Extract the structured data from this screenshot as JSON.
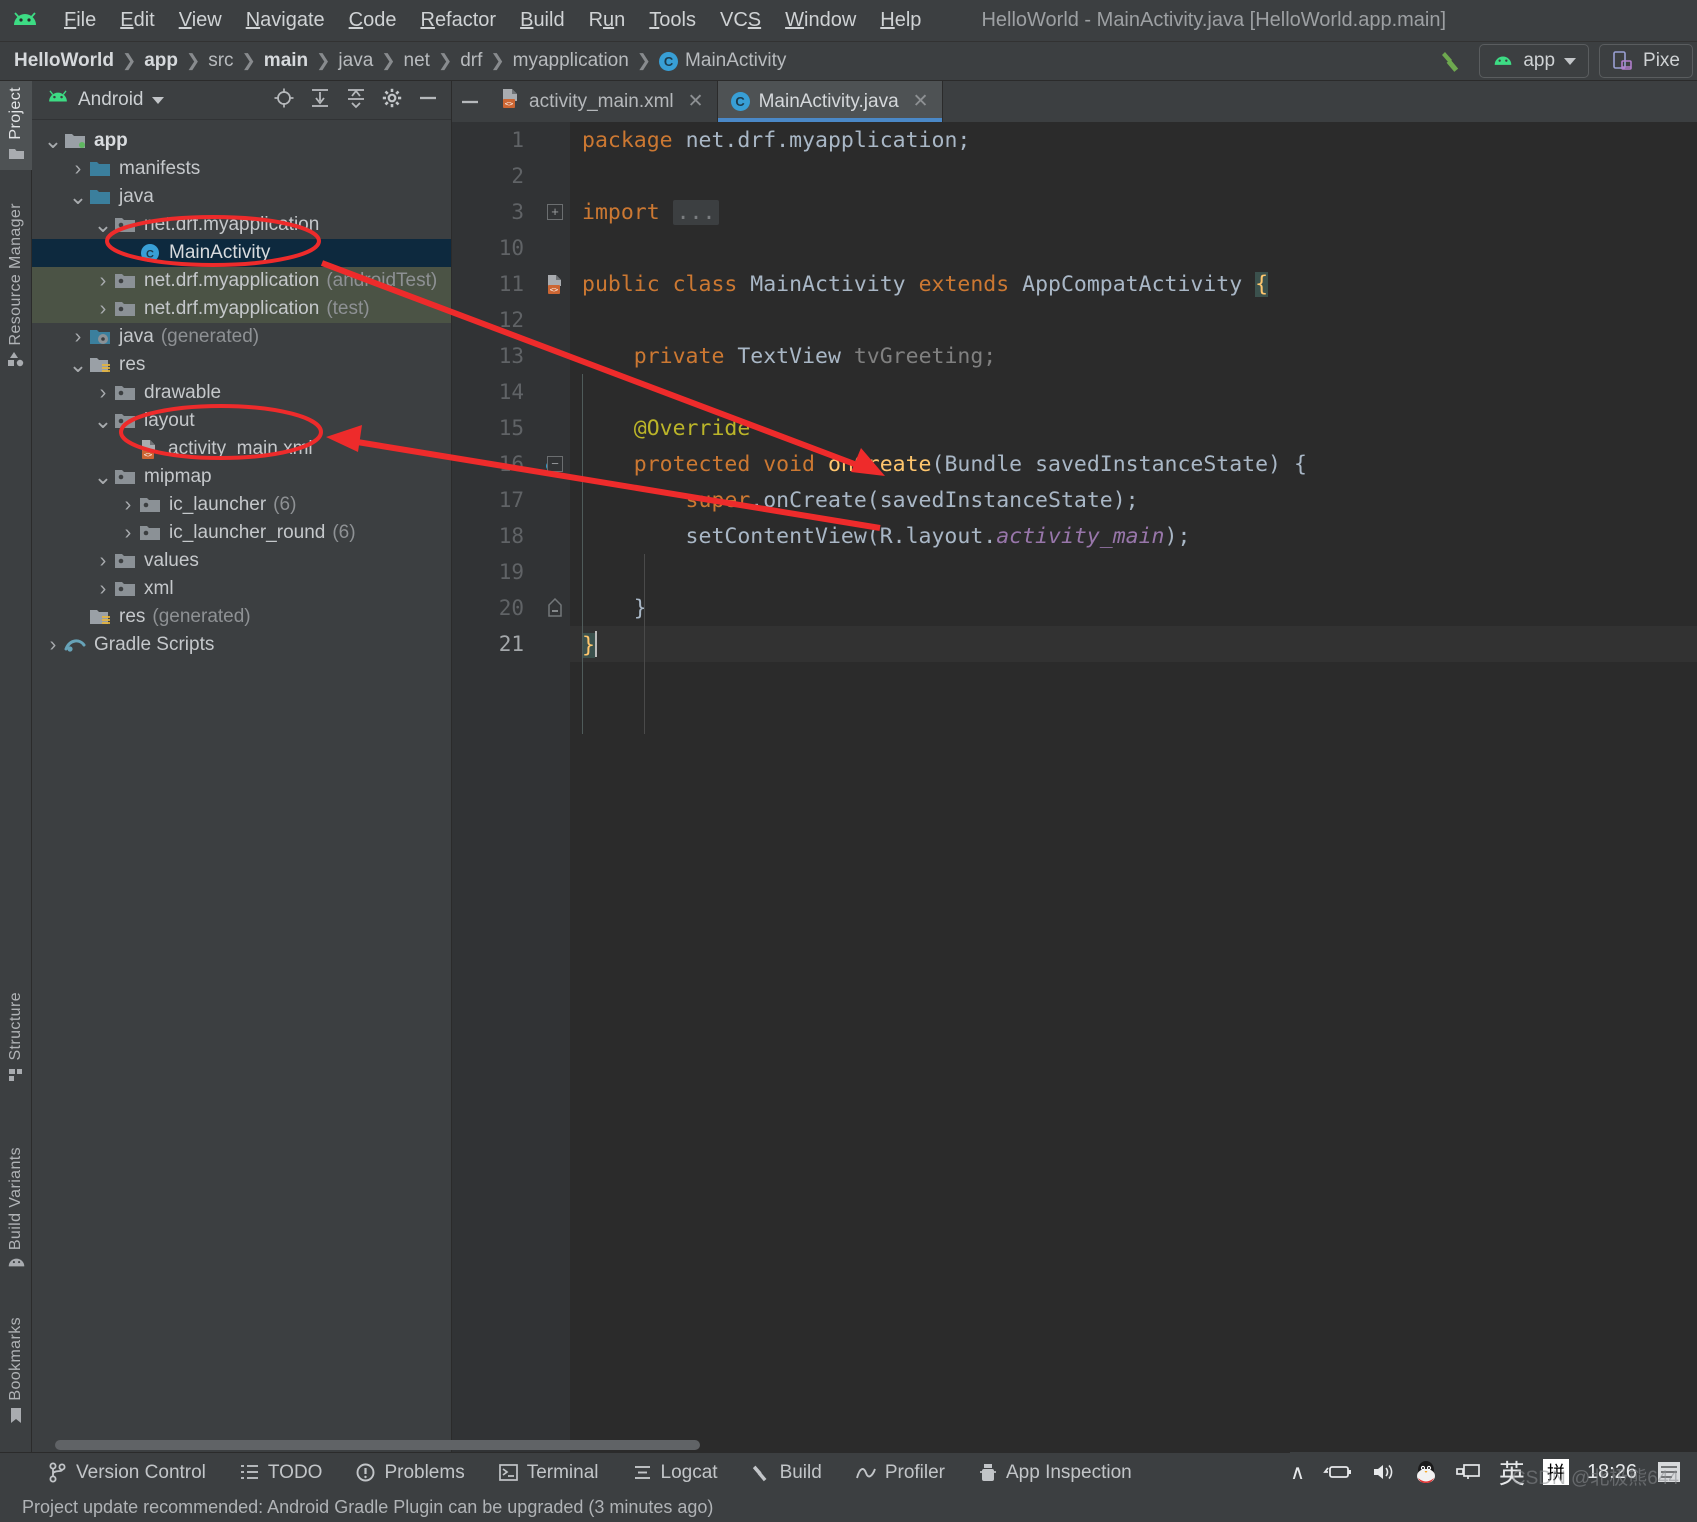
{
  "window": {
    "title": "HelloWorld - MainActivity.java [HelloWorld.app.main]",
    "app_icon": "android-robot-icon"
  },
  "menubar": {
    "items": [
      {
        "label": "File",
        "mnemonic": "F"
      },
      {
        "label": "Edit",
        "mnemonic": "E"
      },
      {
        "label": "View",
        "mnemonic": "V"
      },
      {
        "label": "Navigate",
        "mnemonic": "N"
      },
      {
        "label": "Code",
        "mnemonic": "C"
      },
      {
        "label": "Refactor",
        "mnemonic": "R"
      },
      {
        "label": "Build",
        "mnemonic": "B"
      },
      {
        "label": "Run",
        "mnemonic": "u"
      },
      {
        "label": "Tools",
        "mnemonic": "T"
      },
      {
        "label": "VCS",
        "mnemonic": "S"
      },
      {
        "label": "Window",
        "mnemonic": "W"
      },
      {
        "label": "Help",
        "mnemonic": "H"
      }
    ]
  },
  "breadcrumb": {
    "items": [
      {
        "label": "HelloWorld",
        "bold": true
      },
      {
        "label": "app",
        "bold": true
      },
      {
        "label": "src",
        "bold": false
      },
      {
        "label": "main",
        "bold": true
      },
      {
        "label": "java",
        "bold": false
      },
      {
        "label": "net",
        "bold": false
      },
      {
        "label": "drf",
        "bold": false
      },
      {
        "label": "myapplication",
        "bold": false
      },
      {
        "label": "MainActivity",
        "bold": false,
        "icon": "java-class-icon"
      }
    ],
    "separator": "〉"
  },
  "toolbar_right": {
    "build_icon": "hammer-icon",
    "run_config": "app",
    "run_config_icon": "android-robot-icon",
    "device": "Pixe",
    "device_icon": "device-phone-icon"
  },
  "left_tool_strip": {
    "top": [
      {
        "label": "Project",
        "icon": "folder-icon",
        "active": true
      },
      {
        "label": "Resource Manager",
        "icon": "shapes-icon",
        "active": false
      }
    ],
    "bottom": [
      {
        "label": "Structure",
        "icon": "structure-icon",
        "active": false
      },
      {
        "label": "Build Variants",
        "icon": "android-robot-icon",
        "active": false
      },
      {
        "label": "Bookmarks",
        "icon": "bookmark-icon",
        "active": false
      }
    ]
  },
  "project_panel": {
    "title": "Android",
    "title_icon": "android-robot-icon",
    "header_buttons": [
      {
        "name": "locate-icon"
      },
      {
        "name": "expand-all-icon"
      },
      {
        "name": "collapse-all-icon"
      },
      {
        "name": "gear-icon"
      },
      {
        "name": "minimize-icon"
      }
    ],
    "tree": [
      {
        "indent": 0,
        "chevron": "⌄",
        "icon": "module-folder-icon",
        "label": "app",
        "suffix": "",
        "bold": true,
        "selected": false,
        "testsrc": false
      },
      {
        "indent": 1,
        "chevron": "›",
        "icon": "folder-icon",
        "label": "manifests",
        "suffix": "",
        "bold": false,
        "selected": false,
        "testsrc": false
      },
      {
        "indent": 1,
        "chevron": "⌄",
        "icon": "folder-icon",
        "label": "java",
        "suffix": "",
        "bold": false,
        "selected": false,
        "testsrc": false
      },
      {
        "indent": 2,
        "chevron": "⌄",
        "icon": "package-icon",
        "label": "net.drf.myapplication",
        "suffix": "",
        "bold": false,
        "selected": false,
        "testsrc": false
      },
      {
        "indent": 3,
        "chevron": "",
        "icon": "java-class-icon",
        "label": "MainActivity",
        "suffix": "",
        "bold": false,
        "selected": true,
        "testsrc": false
      },
      {
        "indent": 2,
        "chevron": "›",
        "icon": "package-icon",
        "label": "net.drf.myapplication",
        "suffix": "(androidTest)",
        "bold": false,
        "selected": false,
        "testsrc": true
      },
      {
        "indent": 2,
        "chevron": "›",
        "icon": "package-icon",
        "label": "net.drf.myapplication",
        "suffix": "(test)",
        "bold": false,
        "selected": false,
        "testsrc": true
      },
      {
        "indent": 1,
        "chevron": "›",
        "icon": "generated-folder-icon",
        "label": "java",
        "suffix": "(generated)",
        "bold": false,
        "selected": false,
        "testsrc": false
      },
      {
        "indent": 1,
        "chevron": "⌄",
        "icon": "res-folder-icon",
        "label": "res",
        "suffix": "",
        "bold": false,
        "selected": false,
        "testsrc": false
      },
      {
        "indent": 2,
        "chevron": "›",
        "icon": "package-icon",
        "label": "drawable",
        "suffix": "",
        "bold": false,
        "selected": false,
        "testsrc": false
      },
      {
        "indent": 2,
        "chevron": "⌄",
        "icon": "package-icon",
        "label": "layout",
        "suffix": "",
        "bold": false,
        "selected": false,
        "testsrc": false
      },
      {
        "indent": 3,
        "chevron": "",
        "icon": "xml-layout-icon",
        "label": "activity_main.xml",
        "suffix": "",
        "bold": false,
        "selected": false,
        "testsrc": false
      },
      {
        "indent": 2,
        "chevron": "⌄",
        "icon": "package-icon",
        "label": "mipmap",
        "suffix": "",
        "bold": false,
        "selected": false,
        "testsrc": false
      },
      {
        "indent": 3,
        "chevron": "›",
        "icon": "package-icon",
        "label": "ic_launcher",
        "suffix": "(6)",
        "bold": false,
        "selected": false,
        "testsrc": false
      },
      {
        "indent": 3,
        "chevron": "›",
        "icon": "package-icon",
        "label": "ic_launcher_round",
        "suffix": "(6)",
        "bold": false,
        "selected": false,
        "testsrc": false
      },
      {
        "indent": 2,
        "chevron": "›",
        "icon": "package-icon",
        "label": "values",
        "suffix": "",
        "bold": false,
        "selected": false,
        "testsrc": false
      },
      {
        "indent": 2,
        "chevron": "›",
        "icon": "package-icon",
        "label": "xml",
        "suffix": "",
        "bold": false,
        "selected": false,
        "testsrc": false
      },
      {
        "indent": 1,
        "chevron": "",
        "icon": "res-folder-icon",
        "label": "res",
        "suffix": "(generated)",
        "bold": false,
        "selected": false,
        "testsrc": false
      },
      {
        "indent": 0,
        "chevron": "›",
        "icon": "gradle-icon",
        "label": "Gradle Scripts",
        "suffix": "",
        "bold": false,
        "selected": false,
        "testsrc": false
      }
    ]
  },
  "editor": {
    "tabs": [
      {
        "label": "activity_main.xml",
        "icon": "xml-layout-icon",
        "active": false
      },
      {
        "label": "MainActivity.java",
        "icon": "java-class-icon",
        "active": true
      }
    ],
    "minimize_icon": "minimize-icon",
    "lines": [
      {
        "num": "1",
        "segments": [
          {
            "t": "package ",
            "c": "kw"
          },
          {
            "t": "net.drf.myapplication;",
            "c": "plain"
          }
        ]
      },
      {
        "num": "2",
        "segments": []
      },
      {
        "num": "3",
        "segments": [
          {
            "t": "import ",
            "c": "kw"
          },
          {
            "t": "...",
            "c": "fold-chip"
          }
        ],
        "fold": true
      },
      {
        "num": "10",
        "segments": []
      },
      {
        "num": "11",
        "segments": [
          {
            "t": "public class ",
            "c": "kw"
          },
          {
            "t": "MainActivity ",
            "c": "plain"
          },
          {
            "t": "extends ",
            "c": "kw"
          },
          {
            "t": "AppCompatActivity ",
            "c": "plain"
          },
          {
            "t": "{",
            "c": "brace-hl"
          }
        ],
        "marker": "xml-layout-icon"
      },
      {
        "num": "12",
        "segments": []
      },
      {
        "num": "13",
        "segments": [
          {
            "t": "    private ",
            "c": "kw"
          },
          {
            "t": "TextView ",
            "c": "plain"
          },
          {
            "t": "tvGreeting;",
            "c": "dim"
          }
        ]
      },
      {
        "num": "14",
        "segments": []
      },
      {
        "num": "15",
        "segments": [
          {
            "t": "    @Override",
            "c": "ann"
          }
        ]
      },
      {
        "num": "16",
        "segments": [
          {
            "t": "    protected void ",
            "c": "kw"
          },
          {
            "t": "onCreate",
            "c": "fn"
          },
          {
            "t": "(Bundle savedInstanceState) {",
            "c": "plain"
          }
        ],
        "marker": "override-method-icon",
        "fold_minus": true
      },
      {
        "num": "17",
        "segments": [
          {
            "t": "        super",
            "c": "kw"
          },
          {
            "t": ".onCreate(savedInstanceState);",
            "c": "plain"
          }
        ]
      },
      {
        "num": "18",
        "segments": [
          {
            "t": "        setContentView(R.layout.",
            "c": "plain"
          },
          {
            "t": "activity_main",
            "c": "sfld"
          },
          {
            "t": ");",
            "c": "plain"
          }
        ]
      },
      {
        "num": "19",
        "segments": []
      },
      {
        "num": "20",
        "segments": [
          {
            "t": "    }",
            "c": "plain"
          }
        ],
        "fold_minus_end": true
      },
      {
        "num": "21",
        "segments": [
          {
            "t": "}",
            "c": "brace-hl"
          }
        ],
        "cursor": true,
        "caret_line": true
      }
    ]
  },
  "annotations": {
    "ellipses": [
      {
        "target": "MainActivity tree node"
      },
      {
        "target": "activity_main.xml tree node"
      }
    ],
    "arrows": [
      {
        "from": "MainActivity tree node",
        "to": "onCreate method"
      },
      {
        "from": "setContentView line",
        "to": "activity_main.xml tree node"
      }
    ],
    "color": "#ee2b2b"
  },
  "status_bar": {
    "items": [
      {
        "label": "Version Control",
        "icon": "branch-icon"
      },
      {
        "label": "TODO",
        "icon": "list-icon"
      },
      {
        "label": "Problems",
        "icon": "problems-icon"
      },
      {
        "label": "Terminal",
        "icon": "terminal-icon"
      },
      {
        "label": "Logcat",
        "icon": "logcat-icon"
      },
      {
        "label": "Build",
        "icon": "hammer-icon"
      },
      {
        "label": "Profiler",
        "icon": "profiler-icon"
      },
      {
        "label": "App Inspection",
        "icon": "inspection-icon"
      }
    ]
  },
  "tray": {
    "items": [
      {
        "name": "chevron-up-icon",
        "glyph": "∧"
      },
      {
        "name": "battery-icon",
        "glyph": ""
      },
      {
        "name": "volume-icon",
        "glyph": ""
      },
      {
        "name": "qq-penguin-icon",
        "glyph": ""
      },
      {
        "name": "network-icon",
        "glyph": ""
      },
      {
        "name": "ime-language-icon",
        "glyph": "英"
      },
      {
        "name": "ime-pinyin-icon",
        "glyph": "拼"
      }
    ],
    "time": "18:26",
    "notification_icon": "notification-icon"
  },
  "watermark": {
    "text": "CSDN @北极熊644"
  },
  "bottom_message": {
    "icon": "project-icon",
    "text": "Project update recommended: Android Gradle Plugin can be upgraded (3 minutes ago)"
  }
}
